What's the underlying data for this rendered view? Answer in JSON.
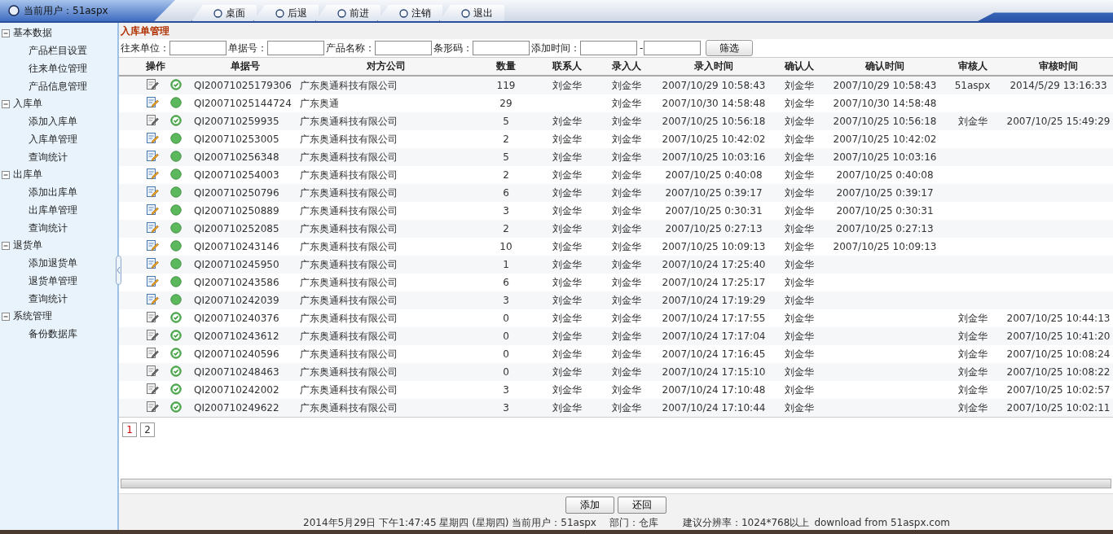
{
  "topbar": {
    "user_label": "当前用户：51aspx",
    "nav": [
      "桌面",
      "后退",
      "前进",
      "注销",
      "退出"
    ]
  },
  "sidebar": [
    {
      "label": "基本数据",
      "expanded": true,
      "children": [
        "产品栏目设置",
        "往来单位管理",
        "产品信息管理"
      ]
    },
    {
      "label": "入库单",
      "expanded": true,
      "children": [
        "添加入库单",
        "入库单管理",
        "查询统计"
      ]
    },
    {
      "label": "出库单",
      "expanded": true,
      "children": [
        "添加出库单",
        "出库单管理",
        "查询统计"
      ]
    },
    {
      "label": "退货单",
      "expanded": true,
      "children": [
        "添加退货单",
        "退货单管理",
        "查询统计"
      ]
    },
    {
      "label": "系统管理",
      "expanded": true,
      "children": [
        "备份数据库"
      ]
    }
  ],
  "page_title": "入库单管理",
  "filters": {
    "fields": [
      "往来单位：",
      "单据号：",
      "产品名称：",
      "条形码："
    ],
    "time_label": "添加时间：",
    "range_separator": "-",
    "button": "筛选"
  },
  "table": {
    "action_header": "操作",
    "columns": [
      "单据号",
      "对方公司",
      "数量",
      "联系人",
      "录入人",
      "录入时间",
      "确认人",
      "确认时间",
      "审核人",
      "审核时间"
    ],
    "rows": [
      {
        "audited": true,
        "cells": [
          "QI20071025179306",
          "广东奥通科技有限公司",
          "119",
          "刘金华",
          "刘金华",
          "2007/10/29 10:58:43",
          "刘金华",
          "2007/10/29 10:58:43",
          "51aspx",
          "2014/5/29 13:16:33"
        ]
      },
      {
        "audited": false,
        "cells": [
          "QI20071025144724",
          "广东奥通",
          "29",
          "",
          "刘金华",
          "2007/10/30 14:58:48",
          "刘金华",
          "2007/10/30 14:58:48",
          "",
          ""
        ]
      },
      {
        "audited": true,
        "cells": [
          "QI200710259935",
          "广东奥通科技有限公司",
          "5",
          "刘金华",
          "刘金华",
          "2007/10/25 10:56:18",
          "刘金华",
          "2007/10/25 10:56:18",
          "刘金华",
          "2007/10/25 15:49:29"
        ]
      },
      {
        "audited": false,
        "cells": [
          "QI200710253005",
          "广东奥通科技有限公司",
          "2",
          "刘金华",
          "刘金华",
          "2007/10/25 10:42:02",
          "刘金华",
          "2007/10/25 10:42:02",
          "",
          ""
        ]
      },
      {
        "audited": false,
        "cells": [
          "QI200710256348",
          "广东奥通科技有限公司",
          "5",
          "刘金华",
          "刘金华",
          "2007/10/25 10:03:16",
          "刘金华",
          "2007/10/25 10:03:16",
          "",
          ""
        ]
      },
      {
        "audited": false,
        "cells": [
          "QI200710254003",
          "广东奥通科技有限公司",
          "2",
          "刘金华",
          "刘金华",
          "2007/10/25 0:40:08",
          "刘金华",
          "2007/10/25 0:40:08",
          "",
          ""
        ]
      },
      {
        "audited": false,
        "cells": [
          "QI200710250796",
          "广东奥通科技有限公司",
          "6",
          "刘金华",
          "刘金华",
          "2007/10/25 0:39:17",
          "刘金华",
          "2007/10/25 0:39:17",
          "",
          ""
        ]
      },
      {
        "audited": false,
        "cells": [
          "QI200710250889",
          "广东奥通科技有限公司",
          "3",
          "刘金华",
          "刘金华",
          "2007/10/25 0:30:31",
          "刘金华",
          "2007/10/25 0:30:31",
          "",
          ""
        ]
      },
      {
        "audited": false,
        "cells": [
          "QI200710252085",
          "广东奥通科技有限公司",
          "2",
          "刘金华",
          "刘金华",
          "2007/10/25 0:27:13",
          "刘金华",
          "2007/10/25 0:27:13",
          "",
          ""
        ]
      },
      {
        "audited": false,
        "cells": [
          "QI200710243146",
          "广东奥通科技有限公司",
          "10",
          "刘金华",
          "刘金华",
          "2007/10/25 10:09:13",
          "刘金华",
          "2007/10/25 10:09:13",
          "",
          ""
        ]
      },
      {
        "audited": false,
        "cells": [
          "QI200710245950",
          "广东奥通科技有限公司",
          "1",
          "刘金华",
          "刘金华",
          "2007/10/24 17:25:40",
          "刘金华",
          "",
          "",
          ""
        ]
      },
      {
        "audited": false,
        "cells": [
          "QI200710243586",
          "广东奥通科技有限公司",
          "6",
          "刘金华",
          "刘金华",
          "2007/10/24 17:25:17",
          "刘金华",
          "",
          "",
          ""
        ]
      },
      {
        "audited": false,
        "cells": [
          "QI200710242039",
          "广东奥通科技有限公司",
          "3",
          "刘金华",
          "刘金华",
          "2007/10/24 17:19:29",
          "刘金华",
          "",
          "",
          ""
        ]
      },
      {
        "audited": true,
        "cells": [
          "QI200710240376",
          "广东奥通科技有限公司",
          "0",
          "刘金华",
          "刘金华",
          "2007/10/24 17:17:55",
          "刘金华",
          "",
          "刘金华",
          "2007/10/25 10:44:13"
        ]
      },
      {
        "audited": true,
        "cells": [
          "QI200710243612",
          "广东奥通科技有限公司",
          "0",
          "刘金华",
          "刘金华",
          "2007/10/24 17:17:04",
          "刘金华",
          "",
          "刘金华",
          "2007/10/25 10:41:20"
        ]
      },
      {
        "audited": true,
        "cells": [
          "QI200710240596",
          "广东奥通科技有限公司",
          "0",
          "刘金华",
          "刘金华",
          "2007/10/24 17:16:45",
          "刘金华",
          "",
          "刘金华",
          "2007/10/25 10:08:24"
        ]
      },
      {
        "audited": true,
        "cells": [
          "QI200710248463",
          "广东奥通科技有限公司",
          "0",
          "刘金华",
          "刘金华",
          "2007/10/24 17:15:10",
          "刘金华",
          "",
          "刘金华",
          "2007/10/25 10:08:22"
        ]
      },
      {
        "audited": true,
        "cells": [
          "QI200710242002",
          "广东奥通科技有限公司",
          "3",
          "刘金华",
          "刘金华",
          "2007/10/24 17:10:48",
          "刘金华",
          "",
          "刘金华",
          "2007/10/25 10:02:57"
        ]
      },
      {
        "audited": true,
        "cells": [
          "QI200710249622",
          "广东奥通科技有限公司",
          "3",
          "刘金华",
          "刘金华",
          "2007/10/24 17:10:44",
          "刘金华",
          "",
          "刘金华",
          "2007/10/25 10:02:11"
        ]
      }
    ]
  },
  "pager": [
    {
      "label": "1",
      "selected": true
    },
    {
      "label": "2",
      "selected": false
    }
  ],
  "buttons": [
    "添加",
    "还回"
  ],
  "status_bar": [
    "2014年5月29日 下午1:47:45 星期四 (星期四) 当前用户：51aspx",
    "部门：仓库",
    "建议分辨率：1024*768以上",
    "download from 51aspx.com"
  ]
}
